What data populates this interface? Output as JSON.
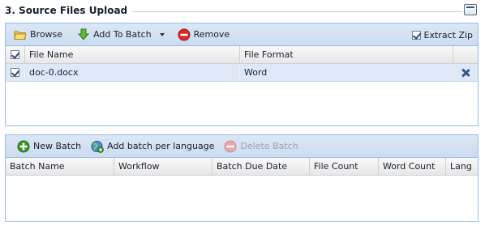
{
  "section": {
    "title": "3. Source Files Upload"
  },
  "upload_toolbar": {
    "browse_label": "Browse",
    "add_to_batch_label": "Add To Batch",
    "remove_label": "Remove",
    "extract_zip_label": "Extract Zip",
    "extract_zip_checked": true
  },
  "files_grid": {
    "columns": [
      "File Name",
      "File Format"
    ],
    "rows": [
      {
        "checked": true,
        "file_name": "doc-0.docx",
        "file_format": "Word"
      }
    ]
  },
  "batch_toolbar": {
    "new_batch_label": "New Batch",
    "add_batch_per_language_label": "Add batch per language",
    "delete_batch_label": "Delete Batch"
  },
  "batch_grid": {
    "columns": [
      "Batch Name",
      "Workflow",
      "Batch Due Date",
      "File Count",
      "Word Count",
      "Lang"
    ]
  },
  "colors": {
    "toolbar_bg": "#cddcf0",
    "panel_border": "#99bbe8",
    "selected_row": "#dfe8f6",
    "remove_icon": "#d52b2b",
    "add_icon": "#3b9a2a"
  }
}
